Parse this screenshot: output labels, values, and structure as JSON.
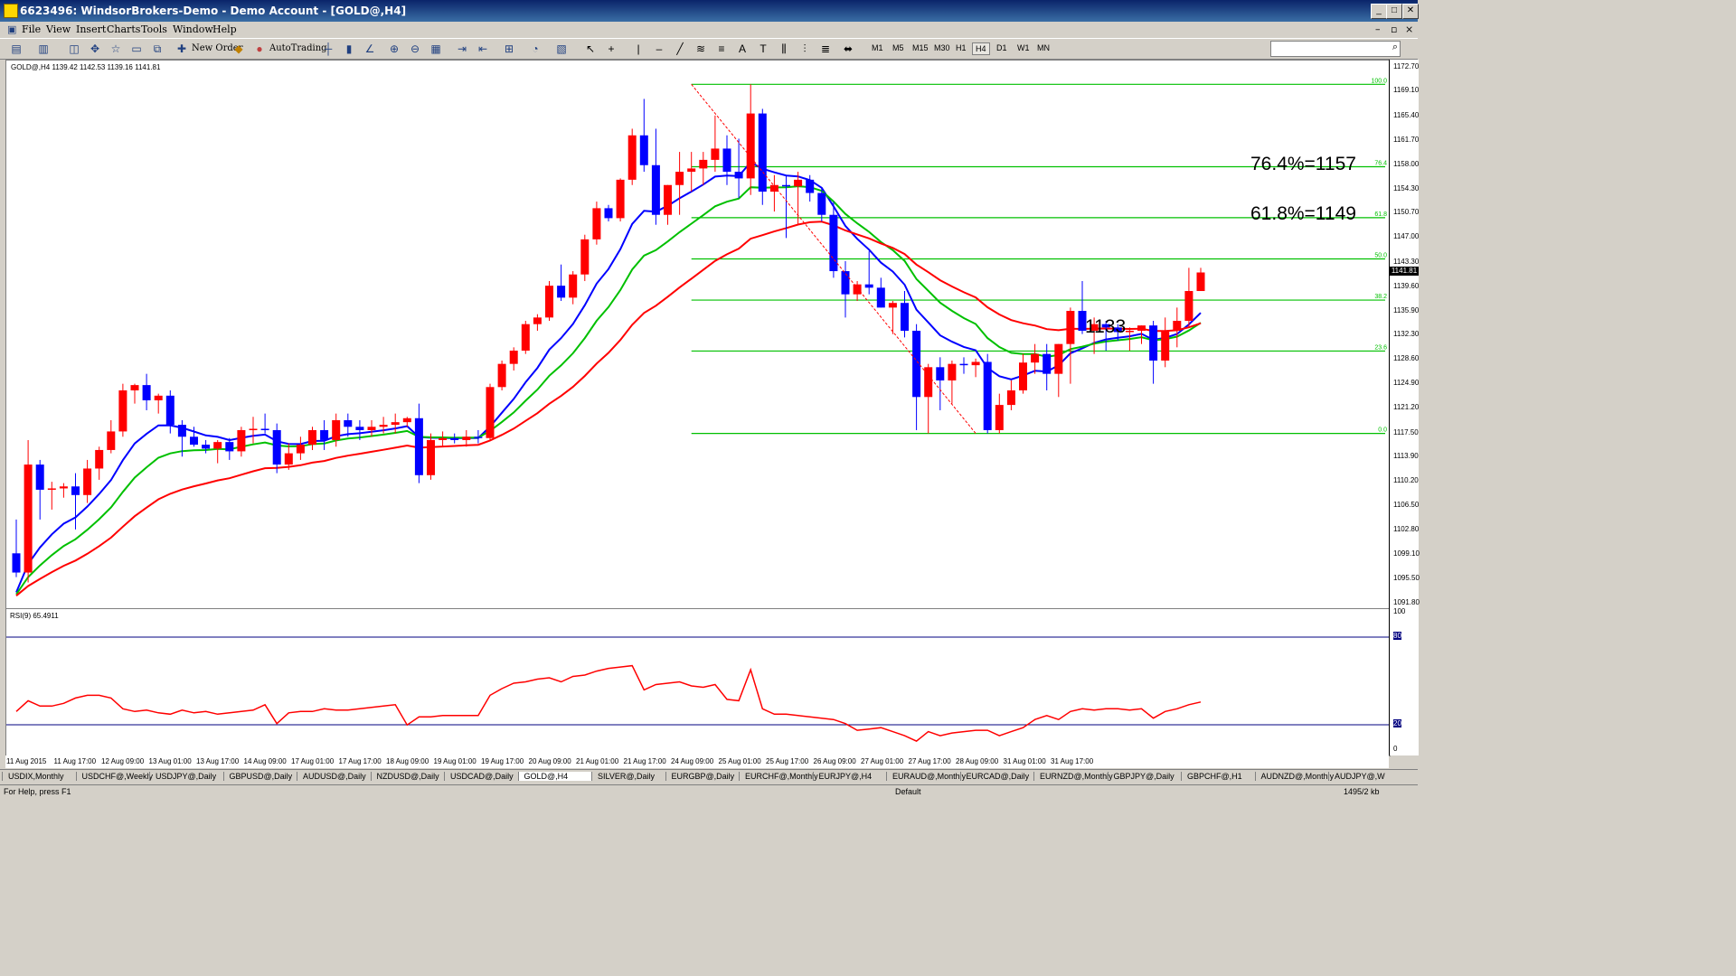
{
  "window": {
    "title": "6623496: WindsorBrokers-Demo - Demo Account - [GOLD@,H4]"
  },
  "menu": [
    "File",
    "View",
    "Insert",
    "Charts",
    "Tools",
    "Window",
    "Help"
  ],
  "toolbar": {
    "new_order": "New Order",
    "autotrading": "AutoTrading",
    "timeframes": [
      "M1",
      "M5",
      "M15",
      "M30",
      "H1",
      "H4",
      "D1",
      "W1",
      "MN"
    ],
    "active_timeframe": "H4"
  },
  "chart": {
    "header": "GOLD@,H4  1139.42 1142.53 1139.16 1141.81",
    "current_price": "1141.81",
    "annotations": {
      "fib764": "76.4%=1157",
      "fib618": "61.8%=1149",
      "level": "1133"
    },
    "fib_labels": [
      "100.0",
      "76.4",
      "61.8",
      "50.0",
      "38.2",
      "23.6",
      "0.0"
    ]
  },
  "rsi": {
    "header": "RSI(9) 65.4911",
    "scale": [
      "100",
      "80",
      "20",
      "0"
    ]
  },
  "price_scale": [
    "1172.70",
    "1169.10",
    "1165.40",
    "1161.70",
    "1158.00",
    "1154.30",
    "1150.70",
    "1147.00",
    "1143.30",
    "1139.60",
    "1135.90",
    "1132.30",
    "1128.60",
    "1124.90",
    "1121.20",
    "1117.50",
    "1113.90",
    "1110.20",
    "1106.50",
    "1102.80",
    "1099.10",
    "1095.50",
    "1091.80"
  ],
  "x_labels": [
    "11 Aug 2015",
    "11 Aug 17:00",
    "12 Aug 09:00",
    "13 Aug 01:00",
    "13 Aug 17:00",
    "14 Aug 09:00",
    "17 Aug 01:00",
    "17 Aug 17:00",
    "18 Aug 09:00",
    "19 Aug 01:00",
    "19 Aug 17:00",
    "20 Aug 09:00",
    "21 Aug 01:00",
    "21 Aug 17:00",
    "24 Aug 09:00",
    "25 Aug 01:00",
    "25 Aug 17:00",
    "26 Aug 09:00",
    "27 Aug 01:00",
    "27 Aug 17:00",
    "28 Aug 09:00",
    "31 Aug 01:00",
    "31 Aug 17:00"
  ],
  "tabs": [
    "USDIX,Monthly",
    "USDCHF@,Weekly",
    "USDJPY@,Daily",
    "GBPUSD@,Daily",
    "AUDUSD@,Daily",
    "NZDUSD@,Daily",
    "USDCAD@,Daily",
    "GOLD@,H4",
    "SILVER@,Daily",
    "EURGBP@,Daily",
    "EURCHF@,Monthly",
    "EURJPY@,H4",
    "EURAUD@,Monthly",
    "EURCAD@,Daily",
    "EURNZD@,Monthly",
    "GBPJPY@,Daily",
    "GBPCHF@,H1",
    "AUDNZD@,Monthly",
    "AUDJPY@,W"
  ],
  "status": {
    "help": "For Help, press F1",
    "profile": "Default",
    "traffic": "1495/2 kb"
  },
  "colors": {
    "bull": "#ff0000",
    "bear": "#0000ff",
    "fib": "#00c000",
    "ma_fast": "#0000ff",
    "ma_mid": "#00c000",
    "ma_slow": "#ff0000",
    "rsi": "#ff0000",
    "rsi_levels": "#000080"
  },
  "candles": [
    [
      1099.4,
      1104.5,
      1095.8,
      1096.5
    ],
    [
      1096.5,
      1116.5,
      1095.0,
      1112.8
    ],
    [
      1112.8,
      1113.5,
      1104.5,
      1109.0
    ],
    [
      1109.0,
      1110.2,
      1106.0,
      1109.2
    ],
    [
      1109.2,
      1110.0,
      1107.8,
      1109.5
    ],
    [
      1109.5,
      1111.5,
      1103.0,
      1108.2
    ],
    [
      1108.2,
      1113.5,
      1107.0,
      1112.2
    ],
    [
      1112.2,
      1115.5,
      1110.5,
      1115.0
    ],
    [
      1115.0,
      1119.5,
      1114.5,
      1117.8
    ],
    [
      1117.8,
      1125.0,
      1117.0,
      1124.0
    ],
    [
      1124.0,
      1125.0,
      1122.0,
      1124.8
    ],
    [
      1124.8,
      1126.5,
      1121.0,
      1122.5
    ],
    [
      1122.5,
      1123.5,
      1120.5,
      1123.2
    ],
    [
      1123.2,
      1124.0,
      1117.5,
      1118.8
    ],
    [
      1118.8,
      1119.5,
      1114.0,
      1117.0
    ],
    [
      1117.0,
      1118.5,
      1115.5,
      1115.8
    ],
    [
      1115.8,
      1116.5,
      1114.5,
      1115.2
    ],
    [
      1115.2,
      1116.5,
      1113.0,
      1116.2
    ],
    [
      1116.2,
      1116.8,
      1113.5,
      1114.8
    ],
    [
      1114.8,
      1118.5,
      1114.0,
      1118.0
    ],
    [
      1118.0,
      1120.0,
      1116.0,
      1118.2
    ],
    [
      1118.2,
      1120.5,
      1117.5,
      1118.0
    ],
    [
      1118.0,
      1119.0,
      1111.5,
      1112.8
    ],
    [
      1112.8,
      1116.0,
      1112.0,
      1114.5
    ],
    [
      1114.5,
      1117.0,
      1113.5,
      1115.8
    ],
    [
      1115.8,
      1118.5,
      1115.0,
      1118.0
    ],
    [
      1118.0,
      1119.5,
      1115.0,
      1116.5
    ],
    [
      1116.5,
      1120.5,
      1115.5,
      1119.5
    ],
    [
      1119.5,
      1120.5,
      1117.0,
      1118.5
    ],
    [
      1118.5,
      1119.5,
      1116.5,
      1118.0
    ],
    [
      1118.0,
      1119.5,
      1117.0,
      1118.5
    ],
    [
      1118.5,
      1120.0,
      1117.5,
      1118.8
    ],
    [
      1118.8,
      1120.5,
      1117.5,
      1119.2
    ],
    [
      1119.2,
      1120.0,
      1118.5,
      1119.8
    ],
    [
      1119.8,
      1122.0,
      1110.0,
      1111.2
    ],
    [
      1111.2,
      1117.5,
      1110.5,
      1116.5
    ],
    [
      1116.5,
      1117.8,
      1115.5,
      1116.8
    ],
    [
      1116.8,
      1117.5,
      1116.0,
      1116.5
    ],
    [
      1116.5,
      1118.0,
      1115.5,
      1117.0
    ],
    [
      1117.0,
      1118.0,
      1116.0,
      1116.8
    ],
    [
      1116.8,
      1125.0,
      1116.5,
      1124.5
    ],
    [
      1124.5,
      1128.5,
      1124.0,
      1128.0
    ],
    [
      1128.0,
      1130.5,
      1127.0,
      1130.0
    ],
    [
      1130.0,
      1134.5,
      1129.5,
      1134.0
    ],
    [
      1134.0,
      1135.5,
      1133.0,
      1135.0
    ],
    [
      1135.0,
      1140.5,
      1134.5,
      1139.8
    ],
    [
      1139.8,
      1143.0,
      1137.5,
      1138.0
    ],
    [
      1138.0,
      1142.0,
      1137.0,
      1141.5
    ],
    [
      1141.5,
      1147.5,
      1140.5,
      1146.8
    ],
    [
      1146.8,
      1152.5,
      1146.0,
      1151.5
    ],
    [
      1151.5,
      1152.0,
      1149.5,
      1150.0
    ],
    [
      1150.0,
      1156.0,
      1149.5,
      1155.8
    ],
    [
      1155.8,
      1163.5,
      1155.0,
      1162.5
    ],
    [
      1162.5,
      1168.0,
      1157.0,
      1158.0
    ],
    [
      1158.0,
      1163.5,
      1149.0,
      1150.5
    ],
    [
      1150.5,
      1155.0,
      1149.0,
      1155.0
    ],
    [
      1155.0,
      1160.0,
      1150.5,
      1157.0
    ],
    [
      1157.0,
      1160.0,
      1154.0,
      1157.5
    ],
    [
      1157.5,
      1160.0,
      1155.0,
      1158.8
    ],
    [
      1158.8,
      1165.5,
      1157.0,
      1160.5
    ],
    [
      1160.5,
      1162.5,
      1155.0,
      1157.0
    ],
    [
      1157.0,
      1162.0,
      1153.0,
      1156.0
    ],
    [
      1156.0,
      1170.2,
      1153.5,
      1165.8
    ],
    [
      1165.8,
      1166.5,
      1152.0,
      1154.0
    ],
    [
      1154.0,
      1156.5,
      1151.0,
      1155.0
    ],
    [
      1155.0,
      1156.5,
      1147.0,
      1154.8
    ],
    [
      1154.8,
      1157.0,
      1149.0,
      1155.8
    ],
    [
      1155.8,
      1156.5,
      1152.5,
      1153.8
    ],
    [
      1153.8,
      1154.5,
      1149.5,
      1150.5
    ],
    [
      1150.5,
      1152.5,
      1141.0,
      1142.0
    ],
    [
      1142.0,
      1143.5,
      1135.0,
      1138.5
    ],
    [
      1138.5,
      1140.5,
      1137.5,
      1140.0
    ],
    [
      1140.0,
      1145.0,
      1138.5,
      1139.5
    ],
    [
      1139.5,
      1141.0,
      1136.5,
      1136.5
    ],
    [
      1136.5,
      1137.5,
      1132.5,
      1137.2
    ],
    [
      1137.2,
      1139.0,
      1132.0,
      1133.0
    ],
    [
      1133.0,
      1134.0,
      1118.0,
      1123.0
    ],
    [
      1123.0,
      1128.0,
      1117.5,
      1127.5
    ],
    [
      1127.5,
      1129.0,
      1121.0,
      1125.5
    ],
    [
      1125.5,
      1128.5,
      1122.0,
      1128.0
    ],
    [
      1128.0,
      1129.0,
      1126.5,
      1127.8
    ],
    [
      1127.8,
      1128.8,
      1126.0,
      1128.3
    ],
    [
      1128.3,
      1129.5,
      1117.5,
      1118.0
    ],
    [
      1118.0,
      1123.5,
      1117.5,
      1121.8
    ],
    [
      1121.8,
      1125.5,
      1121.0,
      1124.0
    ],
    [
      1124.0,
      1129.5,
      1123.5,
      1128.2
    ],
    [
      1128.2,
      1131.0,
      1126.5,
      1129.5
    ],
    [
      1129.5,
      1131.0,
      1124.0,
      1126.5
    ],
    [
      1126.5,
      1131.0,
      1123.0,
      1131.0
    ],
    [
      1131.0,
      1136.5,
      1125.0,
      1136.0
    ],
    [
      1136.0,
      1140.5,
      1132.5,
      1133.0
    ],
    [
      1133.0,
      1135.0,
      1129.5,
      1134.0
    ],
    [
      1134.0,
      1134.5,
      1130.0,
      1133.5
    ],
    [
      1133.5,
      1134.0,
      1131.5,
      1132.8
    ],
    [
      1132.8,
      1133.5,
      1130.0,
      1133.0
    ],
    [
      1133.0,
      1133.8,
      1131.0,
      1133.8
    ],
    [
      1133.8,
      1134.5,
      1125.0,
      1128.5
    ],
    [
      1128.5,
      1135.0,
      1127.5,
      1133.0
    ],
    [
      1133.0,
      1136.5,
      1130.5,
      1134.5
    ],
    [
      1134.5,
      1142.5,
      1133.5,
      1139.0
    ],
    [
      1139.0,
      1142.5,
      1139.0,
      1141.8
    ]
  ],
  "rsi_values": [
    28,
    36,
    32,
    32,
    34,
    38,
    40,
    40,
    38,
    30,
    28,
    29,
    27,
    26,
    29,
    27,
    28,
    26,
    27,
    28,
    29,
    33,
    19,
    27,
    28,
    28,
    30,
    29,
    29,
    30,
    31,
    32,
    33,
    18,
    24,
    24,
    25,
    25,
    25,
    25,
    40,
    45,
    49,
    50,
    52,
    53,
    50,
    54,
    55,
    58,
    60,
    61,
    62,
    44,
    48,
    49,
    50,
    47,
    46,
    48,
    37,
    36,
    59,
    30,
    26,
    26,
    25,
    24,
    23,
    22,
    19,
    14,
    15,
    16,
    13,
    10,
    6,
    13,
    10,
    12,
    13,
    14,
    14,
    10,
    13,
    16,
    22,
    25,
    22,
    28,
    30,
    29,
    30,
    30,
    29,
    30,
    23,
    28,
    30,
    33,
    35
  ]
}
